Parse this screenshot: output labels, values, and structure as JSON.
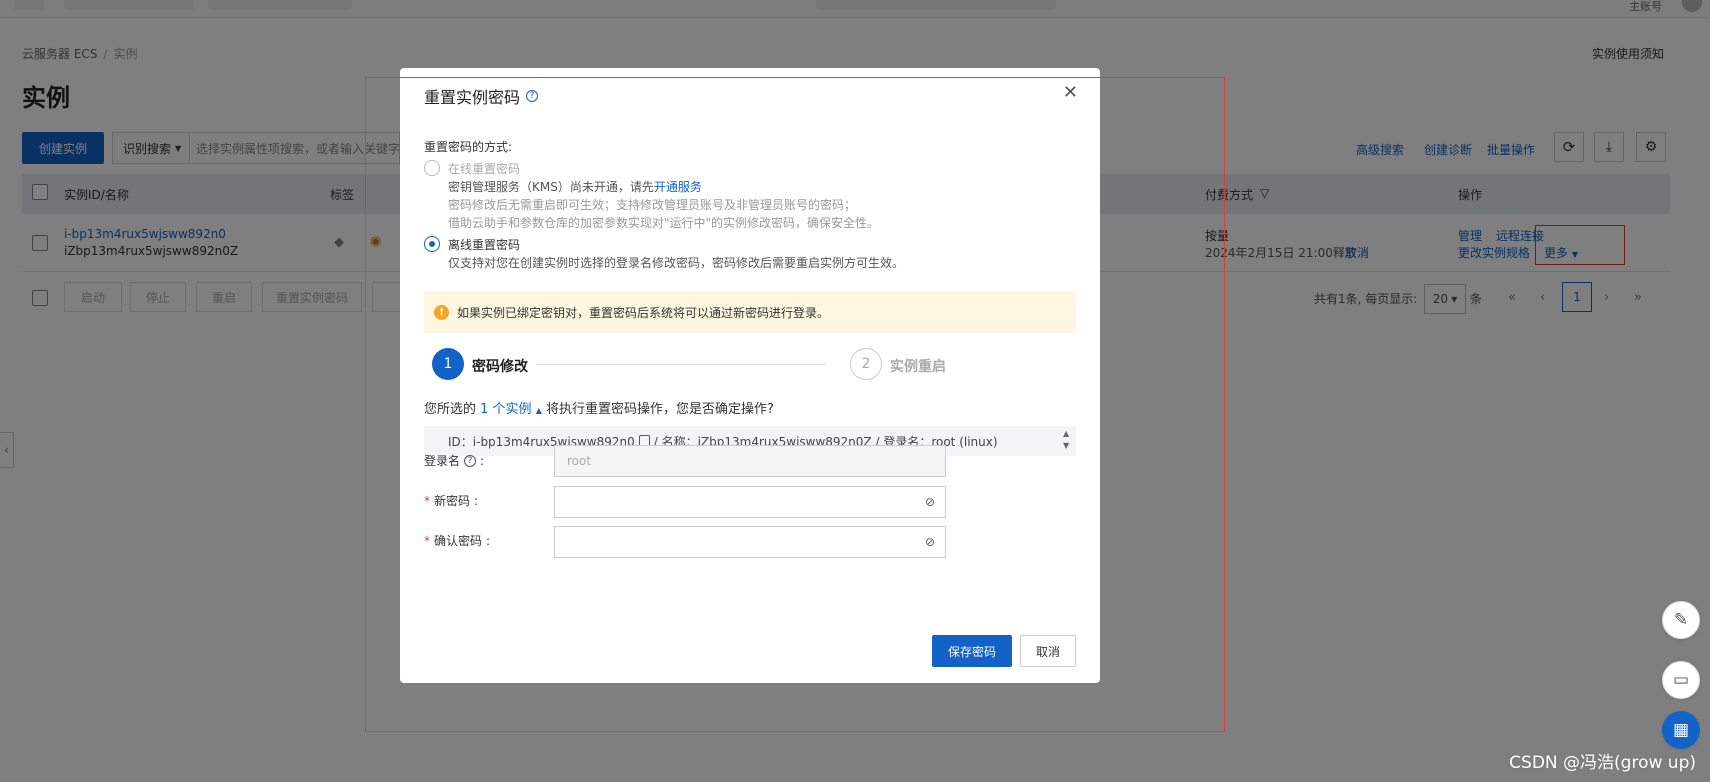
{
  "header": {
    "account": "主账号"
  },
  "breadcrumb": {
    "root": "云服务器 ECS",
    "sep": "/",
    "current": "实例"
  },
  "notice_link": "实例使用须知",
  "page_title": "实例",
  "toolbar": {
    "create_label": "创建实例",
    "search_select": "识别搜索",
    "search_placeholder": "选择实例属性项搜索，或者输入关键字",
    "advanced_search": "高级搜索",
    "create_diagnosis": "创建诊断",
    "batch_ops": "批量操作"
  },
  "table": {
    "headers": {
      "id_name": "实例ID/名称",
      "tag": "标签",
      "payment": "付费方式",
      "actions": "操作"
    },
    "rows": [
      {
        "id": "i-bp13m4rux5wjsww892n0",
        "name": "iZbp13m4rux5wjsww892n0Z",
        "payment_type": "按量",
        "release_time": "2024年2月15日 21:00释放",
        "cancel": "取消",
        "actions": {
          "manage": "管理",
          "remote": "远程连接",
          "change_spec": "更改实例规格",
          "more": "更多"
        }
      }
    ],
    "footer_buttons": [
      "启动",
      "停止",
      "重启",
      "重置实例密码"
    ]
  },
  "pagination": {
    "summary": "共有1条, 每页显示:",
    "page_size": "20",
    "unit": "条",
    "current_page": "1"
  },
  "modal": {
    "title": "重置实例密码",
    "method_label": "重置密码的方式:",
    "online": {
      "title": "在线重置密码",
      "line1_prefix": "密钥管理服务（KMS）尚未开通，请先",
      "line1_link": "开通服务",
      "line2": "密码修改后无需重启即可生效；支持修改管理员账号及非管理员账号的密码；",
      "line3": "借助云助手和参数仓库的加密参数实现对\"运行中\"的实例修改密码，确保安全性。"
    },
    "offline": {
      "title": "离线重置密码",
      "line1": "仅支持对您在创建实例时选择的登录名修改密码，密码修改后需要重启实例方可生效。"
    },
    "alert": "如果实例已绑定密钥对，重置密码后系统将可以通过新密码进行登录。",
    "steps": [
      {
        "num": "1",
        "label": "密码修改"
      },
      {
        "num": "2",
        "label": "实例重启"
      }
    ],
    "selection": {
      "prefix": "您所选的",
      "link": "1 个实例",
      "suffix": "将执行重置密码操作，您是否确定操作?"
    },
    "instance_line_id": "ID：i-bp13m4rux5wjsww892n0",
    "instance_line_rest": "/ 名称：iZbp13m4rux5wjsww892n0Z / 登录名：root (linux)",
    "fields": {
      "login_label": "登录名",
      "login_value": "root",
      "new_pw_label": "新密码",
      "confirm_pw_label": "确认密码",
      "colon": ":"
    },
    "save_label": "保存密码",
    "cancel_label": "取消"
  },
  "watermark": "CSDN @冯浩(grow up)",
  "colors": {
    "primary": "#1262c7",
    "annotation_red": "#e53935",
    "alert_bg": "#fdf6e0"
  }
}
